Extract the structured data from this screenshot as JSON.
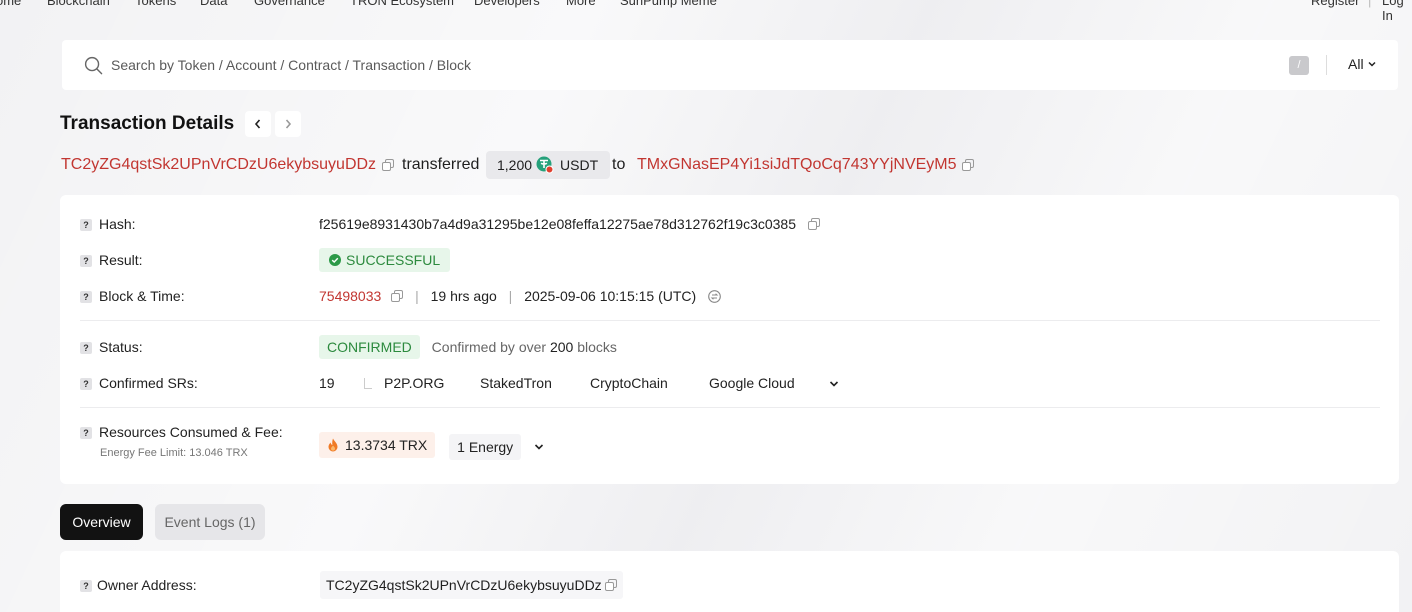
{
  "topnav": {
    "items": [
      "ome",
      "Blockchain",
      "Tokens",
      "Data",
      "Governance",
      "TRON Ecosystem",
      "Developers",
      "More",
      "SunPump Meme"
    ],
    "register": "Register",
    "login": "Log In"
  },
  "search": {
    "placeholder": "Search by Token / Account / Contract / Transaction / Block",
    "shortcut": "/",
    "filter": "All"
  },
  "page": {
    "title": "Transaction Details"
  },
  "summary": {
    "from": "TC2yZG4qstSk2UPnVrCDzU6ekybsuyuDDz",
    "verb": "transferred",
    "amount": "1,200",
    "token": "USDT",
    "to_word": "to",
    "to": "TMxGNasEP4Yi1siJdTQoCq743YYjNVEyM5"
  },
  "details": {
    "hash_label": "Hash:",
    "hash": "f25619e8931430b7a4d9a31295be12e08feffa12275ae78d312762f19c3c0385",
    "result_label": "Result:",
    "result": "SUCCESSFUL",
    "block_label": "Block & Time:",
    "block": "75498033",
    "age": "19 hrs ago",
    "datetime": "2025-09-06 10:15:15 (UTC)",
    "status_label": "Status:",
    "status": "CONFIRMED",
    "confirmed_prefix": "Confirmed by over",
    "confirmed_count": "200",
    "confirmed_suffix": "blocks",
    "srs_label": "Confirmed SRs:",
    "srs_count": "19",
    "srs": [
      "P2P.ORG",
      "StakedTron",
      "CryptoChain",
      "Google Cloud"
    ],
    "resources_label": "Resources Consumed & Fee:",
    "fee_limit": "Energy Fee Limit: 13.046 TRX",
    "fee": "13.3734 TRX",
    "energy": "1 Energy"
  },
  "tabs": {
    "overview": "Overview",
    "event_logs": "Event Logs (1)"
  },
  "overview": {
    "owner_label": "Owner Address:",
    "owner": "TC2yZG4qstSk2UPnVrCDzU6ekybsuyuDDz"
  },
  "colors": {
    "accent_red": "#c23631",
    "success_green": "#2c8a3e",
    "usdt_green": "#26a17b"
  }
}
